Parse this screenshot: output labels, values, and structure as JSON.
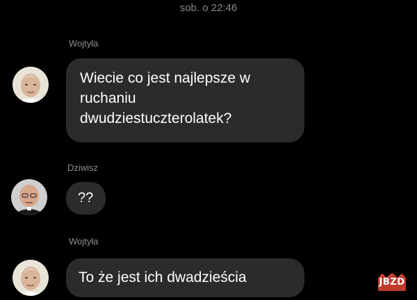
{
  "chat": {
    "timestamp": "sob. o 22:46",
    "messages": [
      {
        "sender": "Wojtyła",
        "text": "Wiecie co jest najlepsze w ruchaniu dwudziestuczterolatek?"
      },
      {
        "sender": "Dziwisz",
        "text": "??"
      },
      {
        "sender": "Wojtyła",
        "text": "To że jest ich dwadzieścia"
      }
    ]
  },
  "watermark": {
    "text": "JBZD",
    "color": "#c0392b"
  },
  "colors": {
    "background": "#000000",
    "bubble": "#2b2b2b",
    "sender_name": "#8e8e8e",
    "timestamp": "#8a8a8a"
  }
}
